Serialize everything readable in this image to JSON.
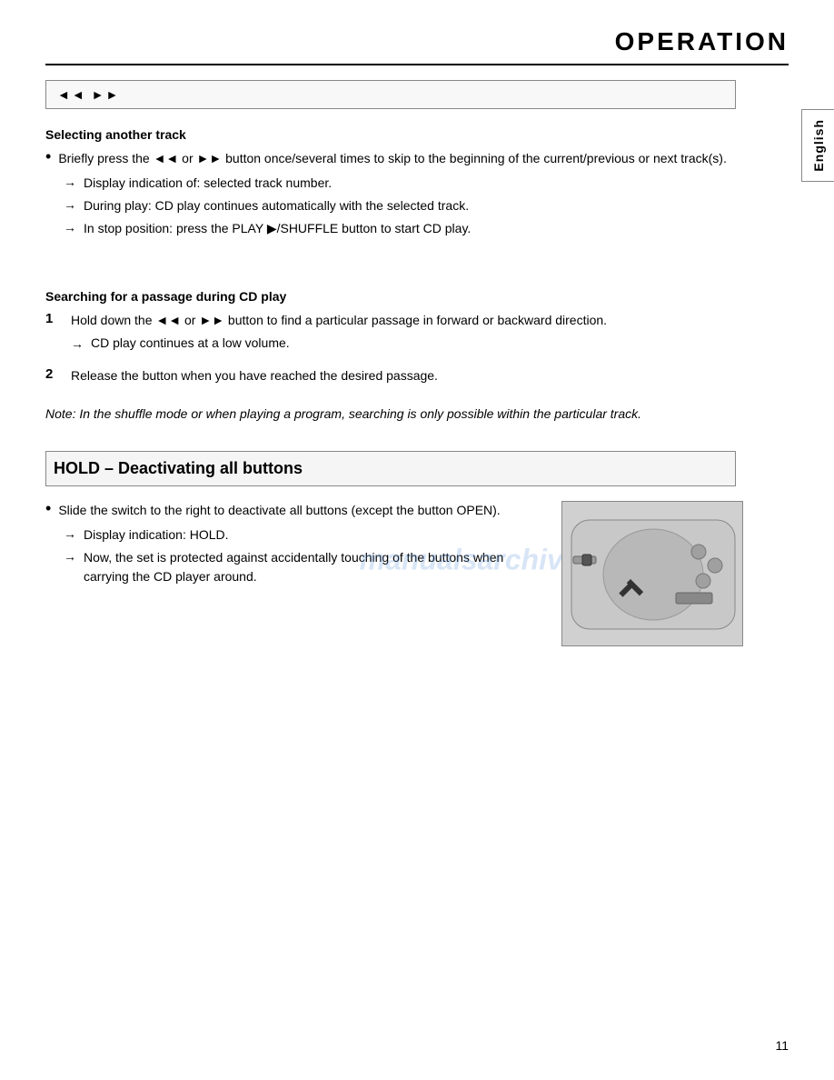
{
  "page": {
    "title": "OPERATION",
    "page_number": "11"
  },
  "button_bar": {
    "icons": "◄◄  ►►"
  },
  "english_tab": {
    "label": "English"
  },
  "selecting_track": {
    "header": "Selecting another track",
    "bullet": "Briefly press the ◄◄  or ►►  button once/several times to skip to the beginning of the current/previous or next track(s).",
    "arrow1": "Display indication of: selected track number.",
    "arrow2": "During play: CD play continues automatically with the selected track.",
    "arrow3": "In stop position: press the PLAY ▶/SHUFFLE button to start CD play."
  },
  "searching": {
    "header": "Searching for a passage during CD play",
    "step1_number": "1",
    "step1_text": "Hold down the ◄◄  or ►►  button to find a particular passage in forward or backward direction.",
    "step1_arrow": "CD play continues at a low volume.",
    "step2_number": "2",
    "step2_text": "Release the button when you have reached the desired passage."
  },
  "note": {
    "text": "Note: In the shuffle mode or when playing a program, searching is only possible within the particular track."
  },
  "hold_section": {
    "header": "HOLD – Deactivating all buttons",
    "bullet": "Slide the switch to the right to deactivate all buttons (except the button OPEN).",
    "arrow1": "Display indication: HOLD.",
    "arrow2": "Now, the set is protected against accidentally touching of the buttons when carrying the CD player around."
  },
  "watermark": {
    "text": "manualsarchive.com"
  }
}
